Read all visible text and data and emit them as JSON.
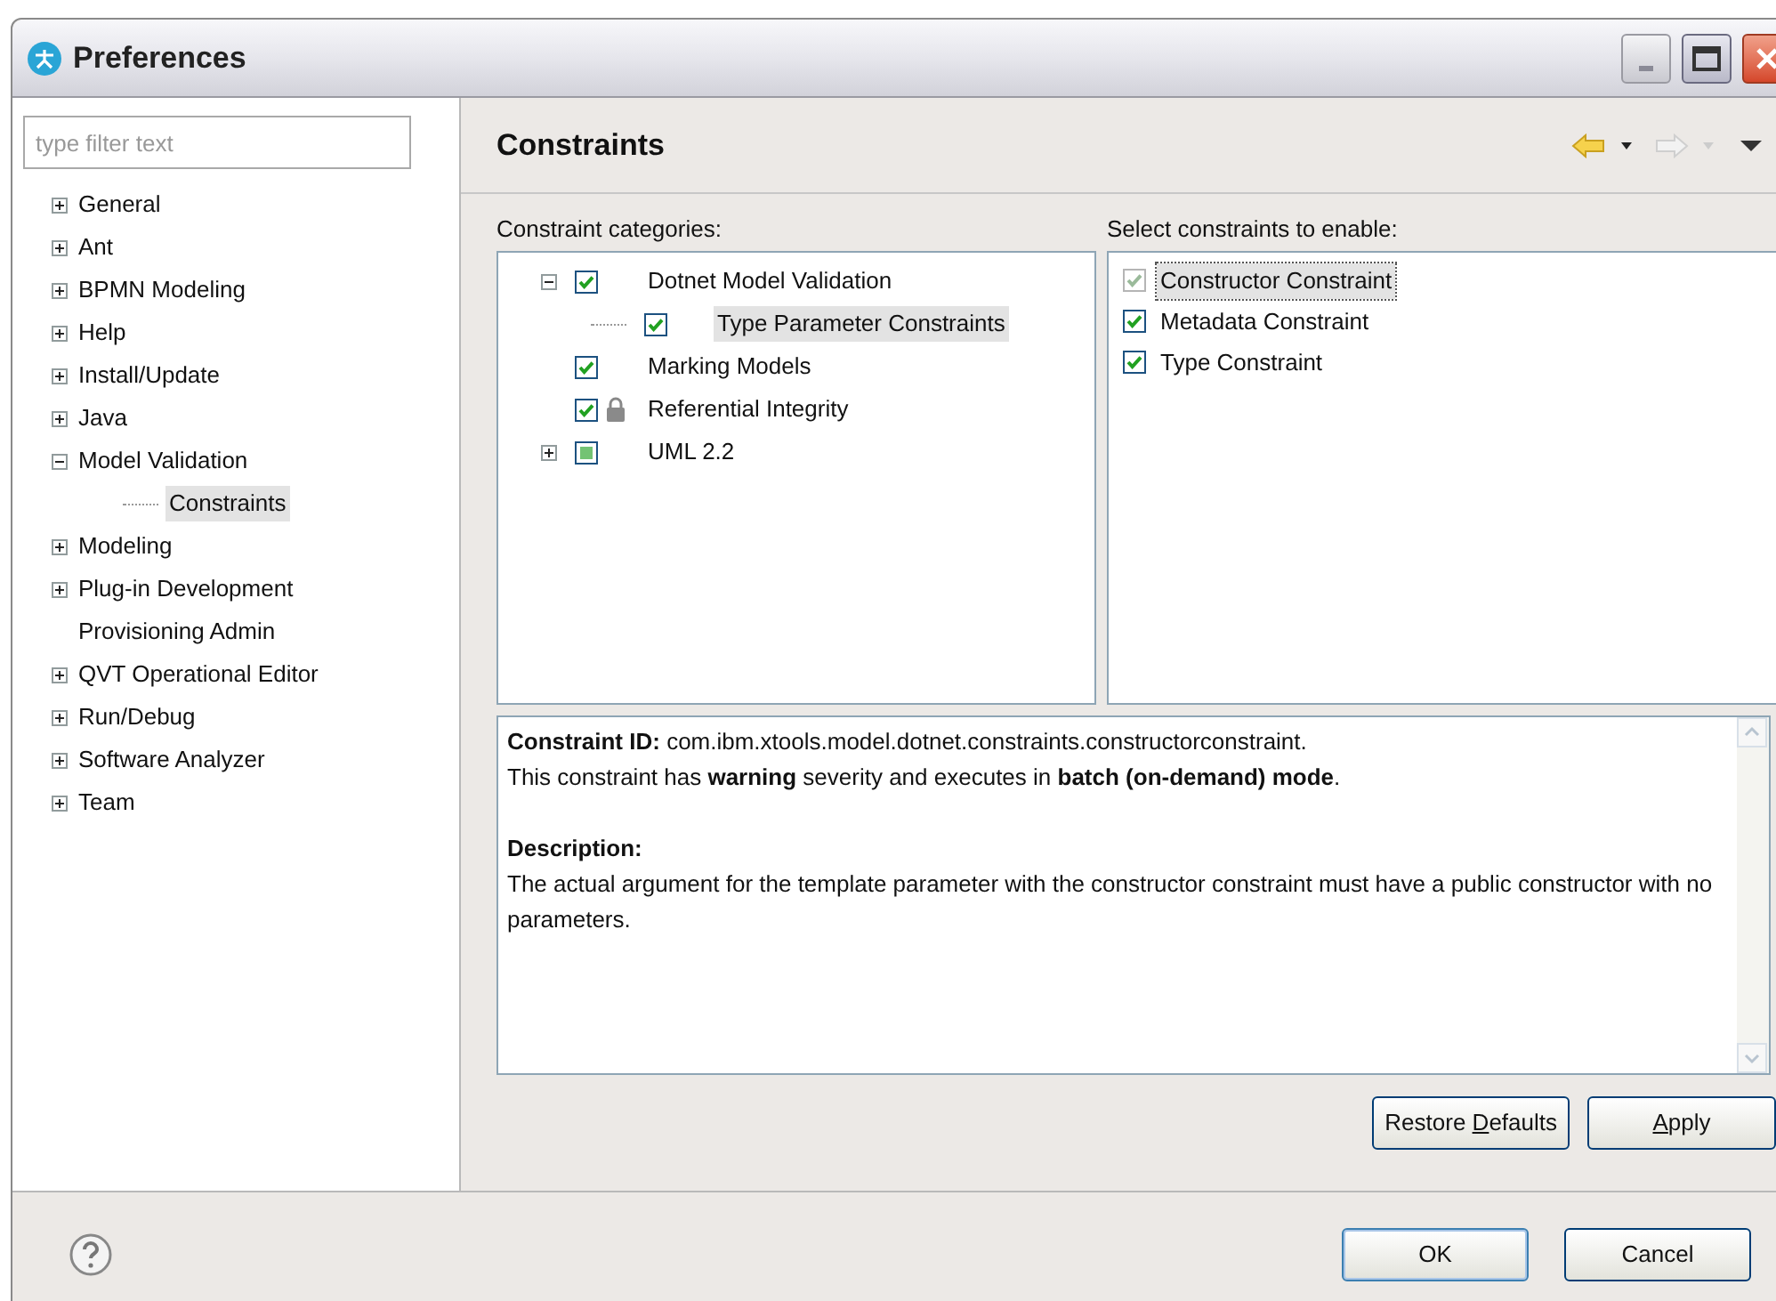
{
  "window": {
    "title": "Preferences"
  },
  "filter": {
    "placeholder": "type filter text"
  },
  "nav": [
    {
      "label": "General",
      "expanded": false,
      "selected": false
    },
    {
      "label": "Ant",
      "expanded": false,
      "selected": false
    },
    {
      "label": "BPMN Modeling",
      "expanded": false,
      "selected": false
    },
    {
      "label": "Help",
      "expanded": false,
      "selected": false
    },
    {
      "label": "Install/Update",
      "expanded": false,
      "selected": false
    },
    {
      "label": "Java",
      "expanded": false,
      "selected": false
    },
    {
      "label": "Model Validation",
      "expanded": true,
      "selected": false,
      "children": [
        {
          "label": "Constraints",
          "selected": true
        }
      ]
    },
    {
      "label": "Modeling",
      "expanded": false,
      "selected": false
    },
    {
      "label": "Plug-in Development",
      "expanded": false,
      "selected": false
    },
    {
      "label": "Provisioning Admin",
      "selected": false
    },
    {
      "label": "QVT Operational Editor",
      "expanded": false,
      "selected": false
    },
    {
      "label": "Run/Debug",
      "expanded": false,
      "selected": false
    },
    {
      "label": "Software Analyzer",
      "expanded": false,
      "selected": false
    },
    {
      "label": "Team",
      "expanded": false,
      "selected": false
    }
  ],
  "page": {
    "title": "Constraints"
  },
  "categories": {
    "label": "Constraint categories:",
    "items": [
      {
        "label": "Dotnet Model Validation",
        "expanded": true,
        "checked": true,
        "mixed": false,
        "locked": false,
        "selected": false,
        "children": [
          {
            "label": "Type Parameter Constraints",
            "checked": true,
            "mixed": false,
            "locked": false,
            "selected": true
          }
        ]
      },
      {
        "label": "Marking Models",
        "checked": true,
        "mixed": false,
        "locked": false,
        "selected": false
      },
      {
        "label": "Referential Integrity",
        "checked": true,
        "mixed": false,
        "locked": true,
        "selected": false
      },
      {
        "label": "UML 2.2",
        "expanded": false,
        "checked": false,
        "mixed": true,
        "locked": false,
        "selected": false
      }
    ]
  },
  "constraints": {
    "label": "Select constraints to enable:",
    "items": [
      {
        "label": "Constructor Constraint",
        "checked": true,
        "disabled": true,
        "selected": true
      },
      {
        "label": "Metadata Constraint",
        "checked": true,
        "disabled": false,
        "selected": false
      },
      {
        "label": "Type Constraint",
        "checked": true,
        "disabled": false,
        "selected": false
      }
    ]
  },
  "details": {
    "lines": [
      "**Constraint ID:** com.ibm.xtools.model.dotnet.constraints.constructorconstraint.",
      "This constraint has **warning** severity and executes in **batch (on-demand) mode**."
    ],
    "heading": "Description:",
    "text": "The actual argument for the template parameter with the constructor constraint must have a public constructor with no parameters."
  },
  "page_buttons": [
    {
      "before": "Restore ",
      "key": "D",
      "after": "efaults"
    },
    {
      "key": "A",
      "after": "pply"
    }
  ],
  "dialog_buttons": [
    "OK",
    "Cancel"
  ]
}
